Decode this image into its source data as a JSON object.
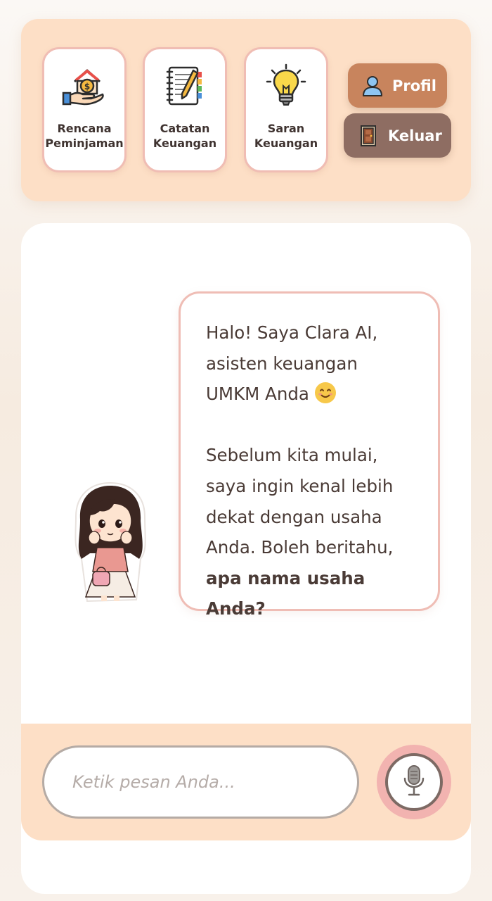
{
  "header": {
    "menu": [
      {
        "line1": "Rencana",
        "line2": "Peminjaman",
        "icon": "loan-house-icon"
      },
      {
        "line1": "Catatan",
        "line2": "Keuangan",
        "icon": "notebook-pencil-icon"
      },
      {
        "line1": "Saran",
        "line2": "Keuangan",
        "icon": "lightbulb-icon"
      }
    ],
    "profil_label": "Profil",
    "keluar_label": "Keluar"
  },
  "chat": {
    "bubble_lines_1": [
      "Halo! Saya Clara AI,",
      "asisten keuangan",
      "UMKM Anda"
    ],
    "bubble_lines_2": [
      "Sebelum kita mulai,",
      "saya ingin kenal lebih",
      "dekat dengan usaha",
      "Anda. Boleh beritahu,"
    ],
    "bubble_bold": "apa nama usaha Anda?",
    "emoji": "smiling-face-emoji"
  },
  "input": {
    "placeholder": "Ketik pesan Anda...",
    "value": ""
  },
  "colors": {
    "header_bg": "#fddfc6",
    "profil_btn": "#c8845d",
    "keluar_btn": "#8e6d62",
    "card_border": "#f0bdb4",
    "bubble_border": "#efbdb5",
    "mic_ring": "#f2b3b0"
  }
}
